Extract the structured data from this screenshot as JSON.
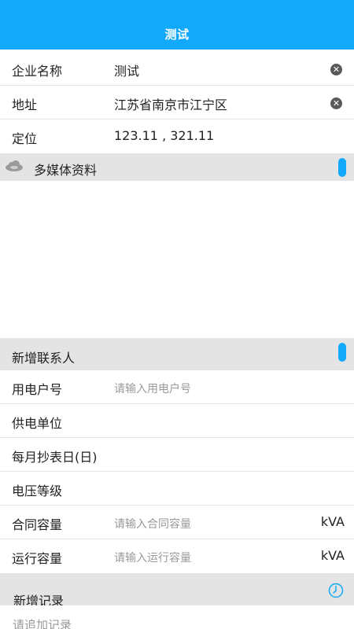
{
  "header": {
    "title": "测试"
  },
  "company": {
    "label": "企业名称",
    "value": "测试"
  },
  "address": {
    "label": "地址",
    "value": "江苏省南京市江宁区"
  },
  "location": {
    "label": "定位",
    "value": "123.11 , 321.11"
  },
  "media": {
    "label": "多媒体资料"
  },
  "contact": {
    "label": "新增联系人"
  },
  "fields": {
    "user_no": {
      "label": "用电户号",
      "placeholder": "请输入用电户号"
    },
    "supplier": {
      "label": "供电单位"
    },
    "read_day": {
      "label": "每月抄表日(日)"
    },
    "voltage": {
      "label": "电压等级"
    },
    "contract_capacity": {
      "label": "合同容量",
      "placeholder": "请输入合同容量",
      "unit": "kVA"
    },
    "running_capacity": {
      "label": "运行容量",
      "placeholder": "请输入运行容量",
      "unit": "kVA"
    }
  },
  "record": {
    "label": "新增记录",
    "placeholder": "请追加记录"
  },
  "icons": {
    "clear": "close-circle-icon",
    "media": "cloud-icon",
    "record": "clock-icon",
    "toggle": "toggle-handle-icon"
  },
  "colors": {
    "accent": "#12a9fb",
    "section_bg": "#e4e4e4"
  }
}
